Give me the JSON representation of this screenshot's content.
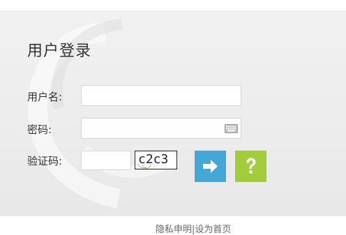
{
  "login": {
    "title": "用户登录",
    "username_label": "用户名:",
    "username_value": "",
    "password_label": "密码:",
    "password_value": "",
    "captcha_label": "验证码:",
    "captcha_value": "",
    "captcha_text": "c2c3"
  },
  "footer": {
    "link_text": "隐私申明|设为首页"
  },
  "icons": {
    "keyboard": "keyboard-icon",
    "submit": "arrow-right-icon",
    "help": "question-mark-icon"
  },
  "colors": {
    "panel_background": "#ececec",
    "submit_button": "#44a7d6",
    "help_button": "#a3cc3c",
    "title_text": "#333333"
  }
}
